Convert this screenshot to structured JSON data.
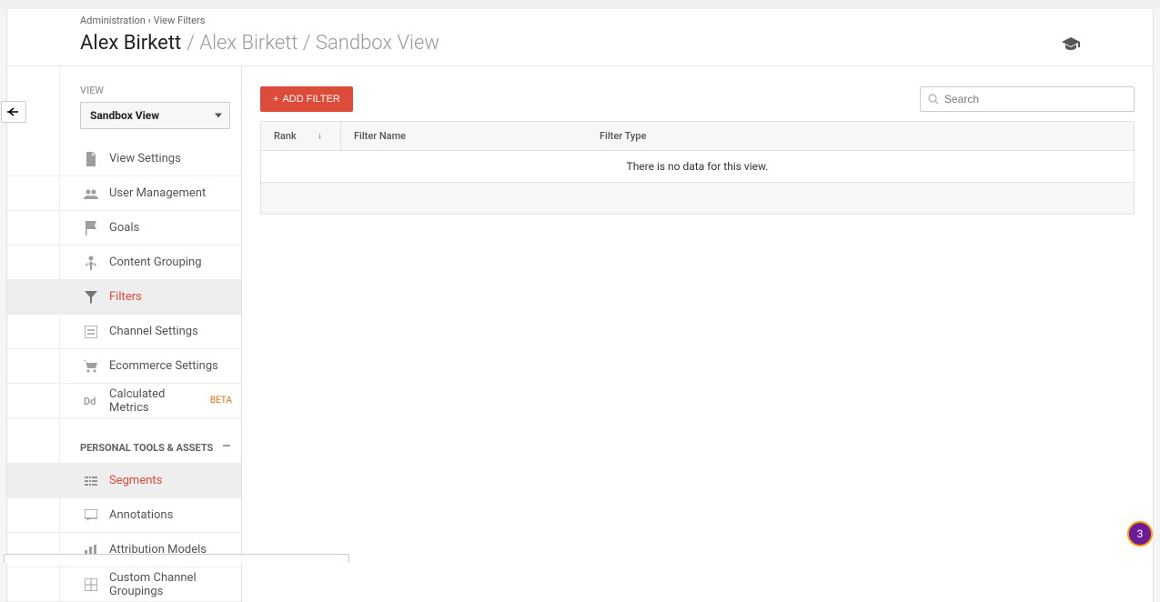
{
  "breadcrumb": {
    "root": "Administration",
    "current": "View Filters",
    "sep": "›"
  },
  "title": {
    "account": "Alex Birkett",
    "path": "/ Alex Birkett / Sandbox View"
  },
  "sidebar": {
    "section_label": "VIEW",
    "view_selector": "Sandbox View",
    "nav": [
      {
        "icon": "doc",
        "label": "View Settings"
      },
      {
        "icon": "users",
        "label": "User Management"
      },
      {
        "icon": "flag",
        "label": "Goals"
      },
      {
        "icon": "person",
        "label": "Content Grouping"
      },
      {
        "icon": "filter",
        "label": "Filters",
        "active": true
      },
      {
        "icon": "channel",
        "label": "Channel Settings"
      },
      {
        "icon": "cart",
        "label": "Ecommerce Settings"
      },
      {
        "icon": "dd",
        "label": "Calculated Metrics",
        "badge": "BETA"
      }
    ],
    "group_header": "PERSONAL TOOLS & ASSETS",
    "nav2": [
      {
        "icon": "segments",
        "label": "Segments",
        "active_red": true
      },
      {
        "icon": "chat",
        "label": "Annotations"
      },
      {
        "icon": "bars",
        "label": "Attribution Models"
      },
      {
        "icon": "grid",
        "label": "Custom Channel Groupings"
      }
    ]
  },
  "toolbar": {
    "add_label": "ADD FILTER",
    "search_placeholder": "Search"
  },
  "table": {
    "col_rank": "Rank",
    "col_name": "Filter Name",
    "col_type": "Filter Type",
    "empty": "There is no data for this view."
  },
  "fab": "3"
}
